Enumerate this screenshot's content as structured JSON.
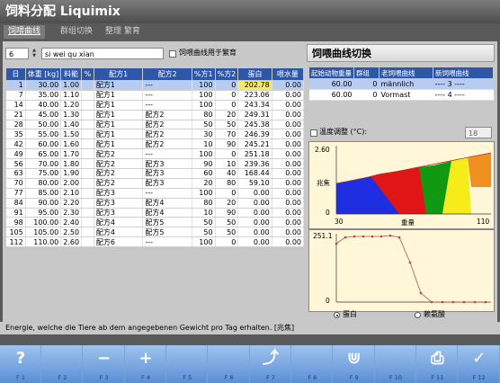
{
  "window": {
    "title": "饲料分配 Liquimix"
  },
  "tabs": [
    {
      "label": "饲喂曲线"
    },
    {
      "label": "群组切换"
    },
    {
      "label": "整理 繁育"
    }
  ],
  "curve_selector": {
    "number": "6",
    "name": "si wei qu xian",
    "checkbox_label": "饲喂曲线用于繁育",
    "checkbox_checked": false
  },
  "table": {
    "headers": [
      "日",
      "体重 [kg]",
      "料能",
      "%",
      "配方1",
      "配方2",
      "%方1",
      "%方2",
      "蛋白",
      "喂水量"
    ],
    "rows": [
      [
        "1",
        "30.00",
        "1.00",
        "配方1",
        "---",
        "100",
        "0",
        "202.78",
        "0.00"
      ],
      [
        "7",
        "35.00",
        "1.10",
        "配方1",
        "---",
        "100",
        "0",
        "223.06",
        "0.00"
      ],
      [
        "14",
        "40.00",
        "1.20",
        "配方1",
        "---",
        "100",
        "0",
        "243.34",
        "0.00"
      ],
      [
        "21",
        "45.00",
        "1.30",
        "配方1",
        "配方2",
        "80",
        "20",
        "249.31",
        "0.00"
      ],
      [
        "28",
        "50.00",
        "1.40",
        "配方1",
        "配方2",
        "50",
        "50",
        "245.38",
        "0.00"
      ],
      [
        "35",
        "55.00",
        "1.50",
        "配方1",
        "配方2",
        "30",
        "70",
        "246.39",
        "0.00"
      ],
      [
        "42",
        "60.00",
        "1.60",
        "配方1",
        "配方2",
        "10",
        "90",
        "245.21",
        "0.00"
      ],
      [
        "49",
        "65.00",
        "1.70",
        "配方2",
        "---",
        "100",
        "0",
        "251.18",
        "0.00"
      ],
      [
        "56",
        "70.00",
        "1.80",
        "配方2",
        "配方3",
        "90",
        "10",
        "239.36",
        "0.00"
      ],
      [
        "63",
        "75.00",
        "1.90",
        "配方2",
        "配方3",
        "60",
        "40",
        "168.44",
        "0.00"
      ],
      [
        "70",
        "80.00",
        "2.00",
        "配方2",
        "配方3",
        "20",
        "80",
        "59.10",
        "0.00"
      ],
      [
        "77",
        "85.00",
        "2.10",
        "配方3",
        "---",
        "100",
        "0",
        "0.00",
        "0.00"
      ],
      [
        "84",
        "90.00",
        "2.20",
        "配方3",
        "配方4",
        "80",
        "20",
        "0.00",
        "0.00"
      ],
      [
        "91",
        "95.00",
        "2.30",
        "配方3",
        "配方4",
        "10",
        "90",
        "0.00",
        "0.00"
      ],
      [
        "98",
        "100.00",
        "2.40",
        "配方4",
        "配方5",
        "50",
        "50",
        "0.00",
        "0.00"
      ],
      [
        "105",
        "105.00",
        "2.50",
        "配方4",
        "配方5",
        "50",
        "50",
        "0.00",
        "0.00"
      ],
      [
        "112",
        "110.00",
        "2.60",
        "配方6",
        "---",
        "100",
        "0",
        "0.00",
        "0.00"
      ]
    ]
  },
  "switch_panel": {
    "title": "饲喂曲线切换",
    "headers": [
      "起始动物重量",
      "群组",
      "老饲喂曲线",
      "新饲喂曲线"
    ],
    "rows": [
      [
        "60.00",
        "0",
        "männlich",
        "---- 3 ----"
      ],
      [
        "60.00",
        "0",
        "Vormast",
        "---- 4 ----"
      ]
    ]
  },
  "temp_adjust": {
    "label": "温度调整 (°C):",
    "value": "18"
  },
  "energy_chart": {
    "ylabel": "兆焦",
    "xlabel": "重量",
    "y_top": "2.60",
    "y_bottom": "0",
    "x_left": "30",
    "x_right": "110",
    "colors": [
      "#1e2ee0",
      "#e01616",
      "#119a11",
      "#f5ec1a",
      "#f09020"
    ]
  },
  "protein_chart": {
    "y_top": "251.1",
    "y_bottom": "0"
  },
  "chart_radio": {
    "option1": "蛋白",
    "option2": "赖氨酸",
    "selected": "option1"
  },
  "status_text": "Energie, welche die Tiere ab dem angegebenen Gewicht pro Tag erhalten. [兆焦]",
  "function_keys": [
    {
      "key": "F 1",
      "symbol": "?",
      "icon": "help-icon"
    },
    {
      "key": "F 2",
      "symbol": "",
      "icon": ""
    },
    {
      "key": "F 3",
      "symbol": "−",
      "icon": "minus-icon"
    },
    {
      "key": "F 4",
      "symbol": "+",
      "icon": "plus-icon"
    },
    {
      "key": "F 5",
      "symbol": "",
      "icon": ""
    },
    {
      "key": "F 6",
      "symbol": "",
      "icon": ""
    },
    {
      "key": "F 7",
      "symbol": "⤴",
      "icon": "curve-switch-icon"
    },
    {
      "key": "F 8",
      "symbol": "",
      "icon": ""
    },
    {
      "key": "F 9",
      "symbol": "⋓",
      "icon": "feed-valves-icon"
    },
    {
      "key": "F 10",
      "symbol": "",
      "icon": ""
    },
    {
      "key": "F 11",
      "symbol": "⎙",
      "icon": "print-icon"
    },
    {
      "key": "F 12",
      "symbol": "✓",
      "icon": "confirm-icon"
    }
  ]
}
